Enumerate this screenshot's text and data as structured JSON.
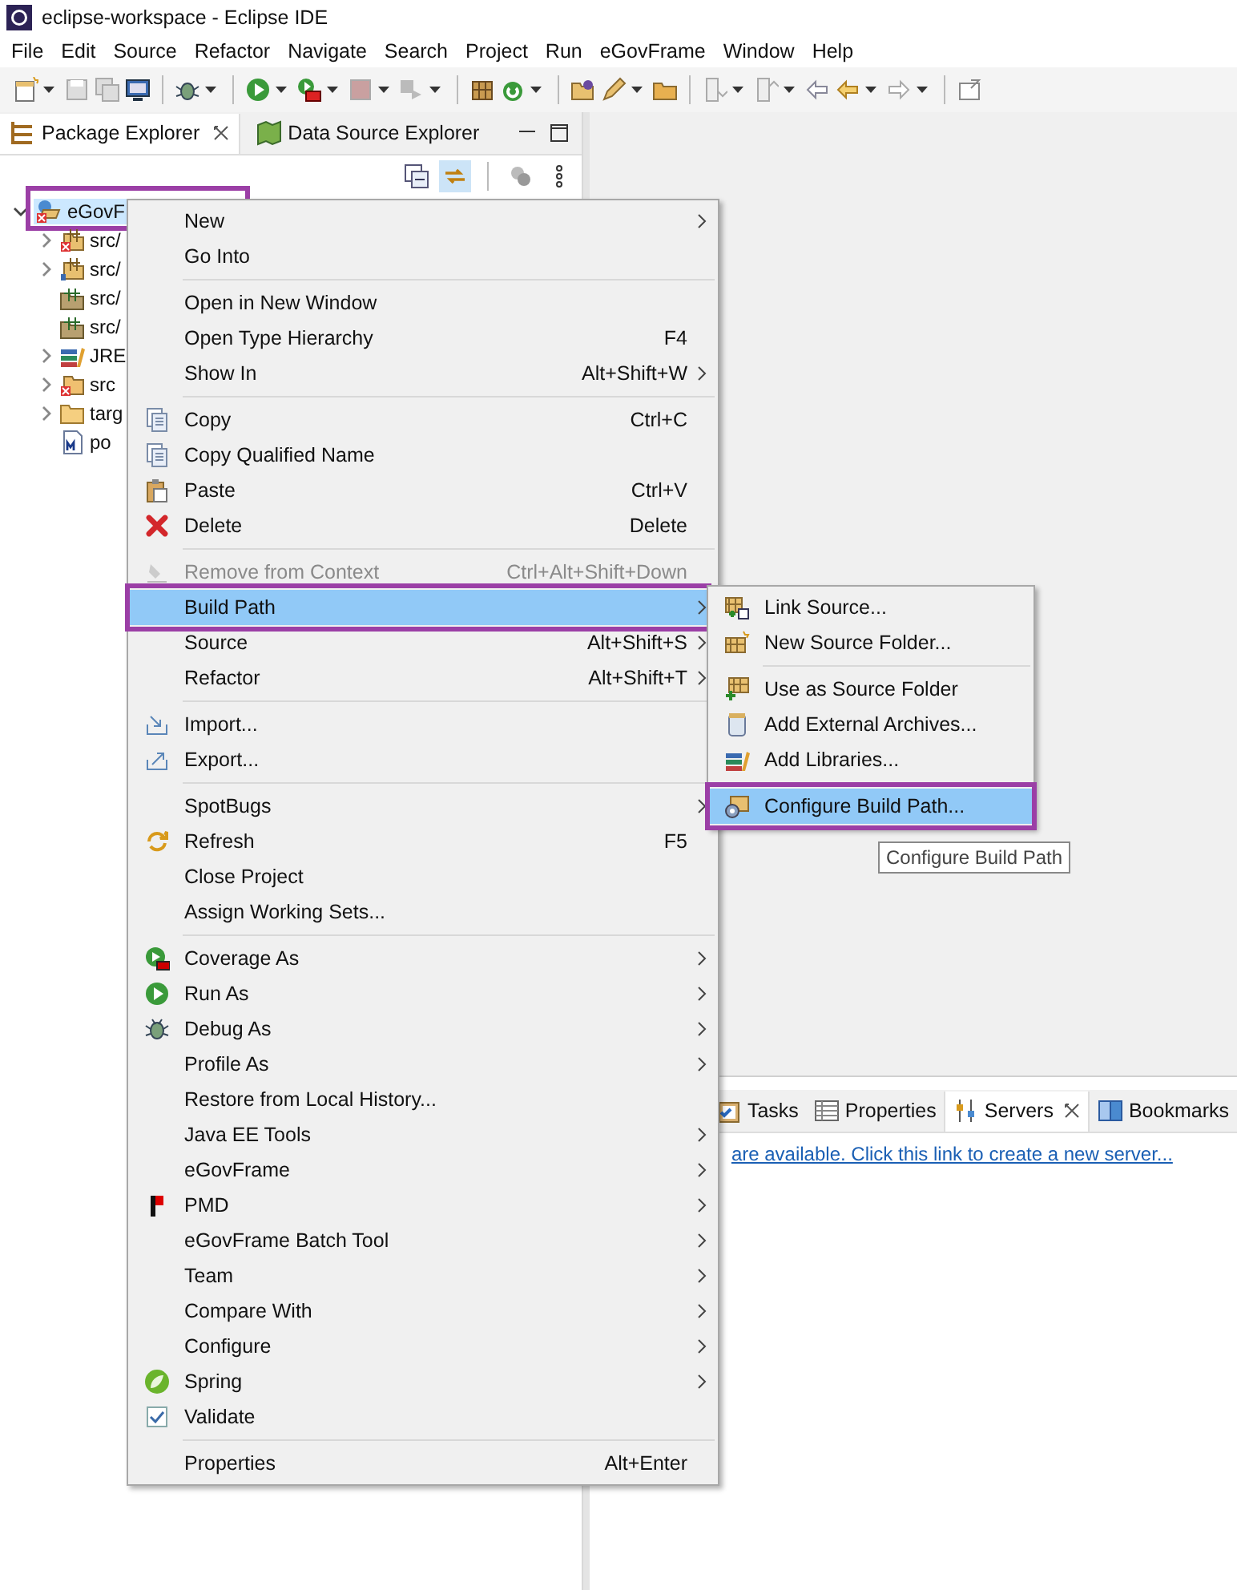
{
  "window": {
    "title": "eclipse-workspace - Eclipse IDE"
  },
  "menu_bar": [
    "File",
    "Edit",
    "Source",
    "Refactor",
    "Navigate",
    "Search",
    "Project",
    "Run",
    "eGovFrame",
    "Window",
    "Help"
  ],
  "package_explorer": {
    "tabs": [
      {
        "label": "Package Explorer",
        "selected": true
      },
      {
        "label": "Data Source Explorer",
        "selected": false
      }
    ],
    "tree": {
      "label": "eGovF",
      "expanded": true,
      "selected": true,
      "highlighted": true,
      "children": [
        {
          "label": "src/",
          "expandable": true
        },
        {
          "label": "src/",
          "expandable": true
        },
        {
          "label": "src/",
          "expandable": false
        },
        {
          "label": "src/",
          "expandable": false
        },
        {
          "label": "JRE",
          "expandable": true
        },
        {
          "label": "src",
          "expandable": true
        },
        {
          "label": "targ",
          "expandable": true
        },
        {
          "label": "po",
          "expandable": false
        }
      ]
    }
  },
  "servers_panel": {
    "tabs": [
      {
        "label": "Tasks",
        "selected": false
      },
      {
        "label": "Properties",
        "selected": false
      },
      {
        "label": "Servers",
        "selected": true
      },
      {
        "label": "Bookmarks",
        "selected": false
      }
    ],
    "link": "are available. Click this link to create a new server..."
  },
  "context_menu": {
    "items": [
      {
        "kind": "item",
        "label": "New",
        "submenu": true,
        "disabled": false,
        "selected": false,
        "highlighted": false
      },
      {
        "kind": "item",
        "label": "Go Into",
        "submenu": false,
        "disabled": false,
        "selected": false,
        "highlighted": false
      },
      {
        "kind": "separator"
      },
      {
        "kind": "item",
        "label": "Open in New Window",
        "submenu": false,
        "disabled": false,
        "selected": false,
        "highlighted": false
      },
      {
        "kind": "item",
        "label": "Open Type Hierarchy",
        "shortcut": "F4",
        "submenu": false,
        "disabled": false,
        "selected": false,
        "highlighted": false
      },
      {
        "kind": "item",
        "label": "Show In",
        "shortcut": "Alt+Shift+W",
        "submenu": true,
        "disabled": false,
        "selected": false,
        "highlighted": false
      },
      {
        "kind": "separator"
      },
      {
        "kind": "item",
        "label": "Copy",
        "shortcut": "Ctrl+C",
        "submenu": false,
        "disabled": false,
        "selected": false,
        "highlighted": false
      },
      {
        "kind": "item",
        "label": "Copy Qualified Name",
        "submenu": false,
        "disabled": false,
        "selected": false,
        "highlighted": false
      },
      {
        "kind": "item",
        "label": "Paste",
        "shortcut": "Ctrl+V",
        "submenu": false,
        "disabled": false,
        "selected": false,
        "highlighted": false
      },
      {
        "kind": "item",
        "label": "Delete",
        "shortcut": "Delete",
        "submenu": false,
        "disabled": false,
        "selected": false,
        "highlighted": false
      },
      {
        "kind": "separator"
      },
      {
        "kind": "item",
        "label": "Remove from Context",
        "shortcut": "Ctrl+Alt+Shift+Down",
        "submenu": false,
        "disabled": true,
        "selected": false,
        "highlighted": false
      },
      {
        "kind": "item",
        "label": "Build Path",
        "submenu": true,
        "disabled": false,
        "selected": true,
        "highlighted": true
      },
      {
        "kind": "item",
        "label": "Source",
        "shortcut": "Alt+Shift+S",
        "submenu": true,
        "disabled": false,
        "selected": false,
        "highlighted": false
      },
      {
        "kind": "item",
        "label": "Refactor",
        "shortcut": "Alt+Shift+T",
        "submenu": true,
        "disabled": false,
        "selected": false,
        "highlighted": false
      },
      {
        "kind": "separator"
      },
      {
        "kind": "item",
        "label": "Import...",
        "submenu": false,
        "disabled": false,
        "selected": false,
        "highlighted": false
      },
      {
        "kind": "item",
        "label": "Export...",
        "submenu": false,
        "disabled": false,
        "selected": false,
        "highlighted": false
      },
      {
        "kind": "separator"
      },
      {
        "kind": "item",
        "label": "SpotBugs",
        "submenu": true,
        "disabled": false,
        "selected": false,
        "highlighted": false
      },
      {
        "kind": "item",
        "label": "Refresh",
        "shortcut": "F5",
        "submenu": false,
        "disabled": false,
        "selected": false,
        "highlighted": false
      },
      {
        "kind": "item",
        "label": "Close Project",
        "submenu": false,
        "disabled": false,
        "selected": false,
        "highlighted": false
      },
      {
        "kind": "item",
        "label": "Assign Working Sets...",
        "submenu": false,
        "disabled": false,
        "selected": false,
        "highlighted": false
      },
      {
        "kind": "separator"
      },
      {
        "kind": "item",
        "label": "Coverage As",
        "submenu": true,
        "disabled": false,
        "selected": false,
        "highlighted": false
      },
      {
        "kind": "item",
        "label": "Run As",
        "submenu": true,
        "disabled": false,
        "selected": false,
        "highlighted": false
      },
      {
        "kind": "item",
        "label": "Debug As",
        "submenu": true,
        "disabled": false,
        "selected": false,
        "highlighted": false
      },
      {
        "kind": "item",
        "label": "Profile As",
        "submenu": true,
        "disabled": false,
        "selected": false,
        "highlighted": false
      },
      {
        "kind": "item",
        "label": "Restore from Local History...",
        "submenu": false,
        "disabled": false,
        "selected": false,
        "highlighted": false
      },
      {
        "kind": "item",
        "label": "Java EE Tools",
        "submenu": true,
        "disabled": false,
        "selected": false,
        "highlighted": false
      },
      {
        "kind": "item",
        "label": "eGovFrame",
        "submenu": true,
        "disabled": false,
        "selected": false,
        "highlighted": false
      },
      {
        "kind": "item",
        "label": "PMD",
        "submenu": true,
        "disabled": false,
        "selected": false,
        "highlighted": false
      },
      {
        "kind": "item",
        "label": "eGovFrame Batch Tool",
        "submenu": true,
        "disabled": false,
        "selected": false,
        "highlighted": false
      },
      {
        "kind": "item",
        "label": "Team",
        "submenu": true,
        "disabled": false,
        "selected": false,
        "highlighted": false
      },
      {
        "kind": "item",
        "label": "Compare With",
        "submenu": true,
        "disabled": false,
        "selected": false,
        "highlighted": false
      },
      {
        "kind": "item",
        "label": "Configure",
        "submenu": true,
        "disabled": false,
        "selected": false,
        "highlighted": false
      },
      {
        "kind": "item",
        "label": "Spring",
        "submenu": true,
        "disabled": false,
        "selected": false,
        "highlighted": false
      },
      {
        "kind": "item",
        "label": "Validate",
        "submenu": false,
        "disabled": false,
        "selected": false,
        "highlighted": false
      },
      {
        "kind": "separator"
      },
      {
        "kind": "item",
        "label": "Properties",
        "shortcut": "Alt+Enter",
        "submenu": false,
        "disabled": false,
        "selected": false,
        "highlighted": false
      }
    ]
  },
  "submenu": {
    "items": [
      {
        "kind": "item",
        "label": "Link Source...",
        "selected": false,
        "highlighted": false
      },
      {
        "kind": "item",
        "label": "New Source Folder...",
        "selected": false,
        "highlighted": false
      },
      {
        "kind": "separator"
      },
      {
        "kind": "item",
        "label": "Use as Source Folder",
        "selected": false,
        "highlighted": false
      },
      {
        "kind": "item",
        "label": "Add External Archives...",
        "selected": false,
        "highlighted": false
      },
      {
        "kind": "item",
        "label": "Add Libraries...",
        "selected": false,
        "highlighted": false
      },
      {
        "kind": "separator"
      },
      {
        "kind": "item",
        "label": "Configure Build Path...",
        "selected": true,
        "highlighted": true
      }
    ]
  },
  "tooltip": "Configure Build Path"
}
